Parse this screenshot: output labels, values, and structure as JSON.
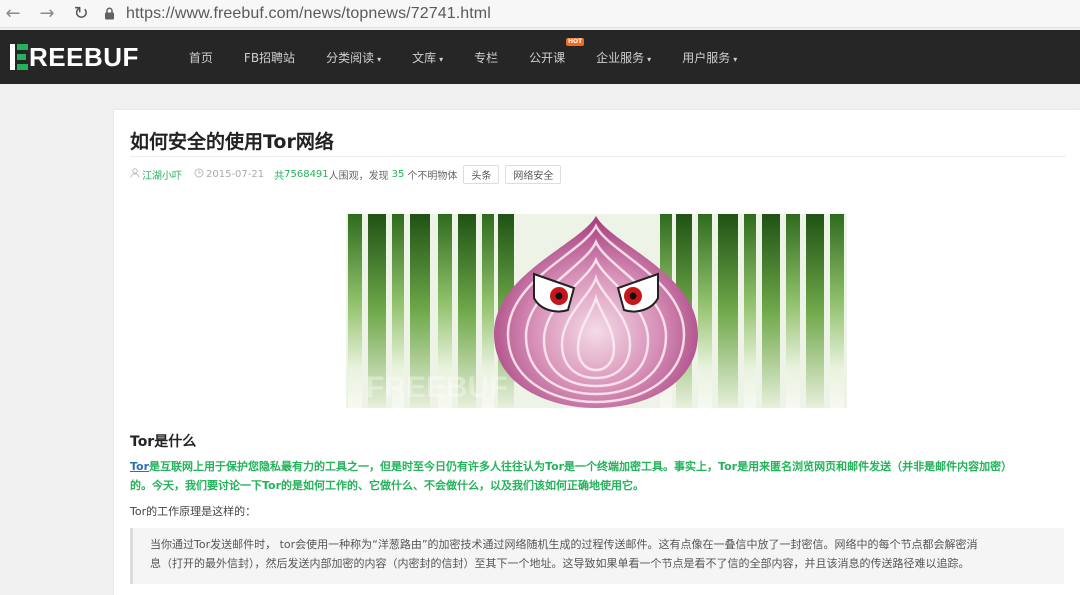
{
  "browser": {
    "url": "https://www.freebuf.com/news/topnews/72741.html",
    "back_icon": "←",
    "forward_icon": "→",
    "reload_icon": "↻"
  },
  "site": {
    "logo_text": "REEBUF",
    "brand_color": "#24b35b",
    "nav": [
      {
        "label": "首页"
      },
      {
        "label": "FB招聘站"
      },
      {
        "label": "分类阅读",
        "caret": "▾"
      },
      {
        "label": "文库",
        "caret": "▾"
      },
      {
        "label": "专栏"
      },
      {
        "label": "公开课",
        "badge": "HOT"
      },
      {
        "label": "企业服务",
        "caret": "▾"
      },
      {
        "label": "用户服务",
        "caret": "▾"
      }
    ]
  },
  "article": {
    "title": "如何安全的使用Tor网络",
    "author": "江湖小吓",
    "date": "2015-07-21",
    "views_prefix": "共",
    "views": "7568491",
    "views_suffix": "人围观，发现",
    "finds": "35",
    "finds_suffix": "个不明物体",
    "tags": [
      "头条",
      "网络安全"
    ],
    "image_watermark": "FREEBUF",
    "section_title": "Tor是什么",
    "intro_link": "Tor",
    "intro_line1": "是互联网上用于保护您隐私最有力的工具之一，但是时至今日仍有许多人往往认为Tor是一个终端加密工具。事实上，Tor是用来匿名浏览网页和邮件发送（并非是邮件内容加密）",
    "intro_line2": "的。今天，我们要讨论一下Tor的是如何工作的、它做什么、不会做什么，以及我们该如何正确地使用它。",
    "principle_heading": "Tor的工作原理是这样的：",
    "quote_line1": "当你通过Tor发送邮件时， tor会使用一种称为“洋葱路由”的加密技术通过网络随机生成的过程传送邮件。这有点像在一叠信中放了一封密信。网络中的每个节点都会解密消",
    "quote_line2": "息（打开的最外信封），然后发送内部加密的内容（内密封的信封）至其下一个地址。这导致如果单看一个节点是看不了信的全部内容，并且该消息的传送路径难以追踪。"
  }
}
